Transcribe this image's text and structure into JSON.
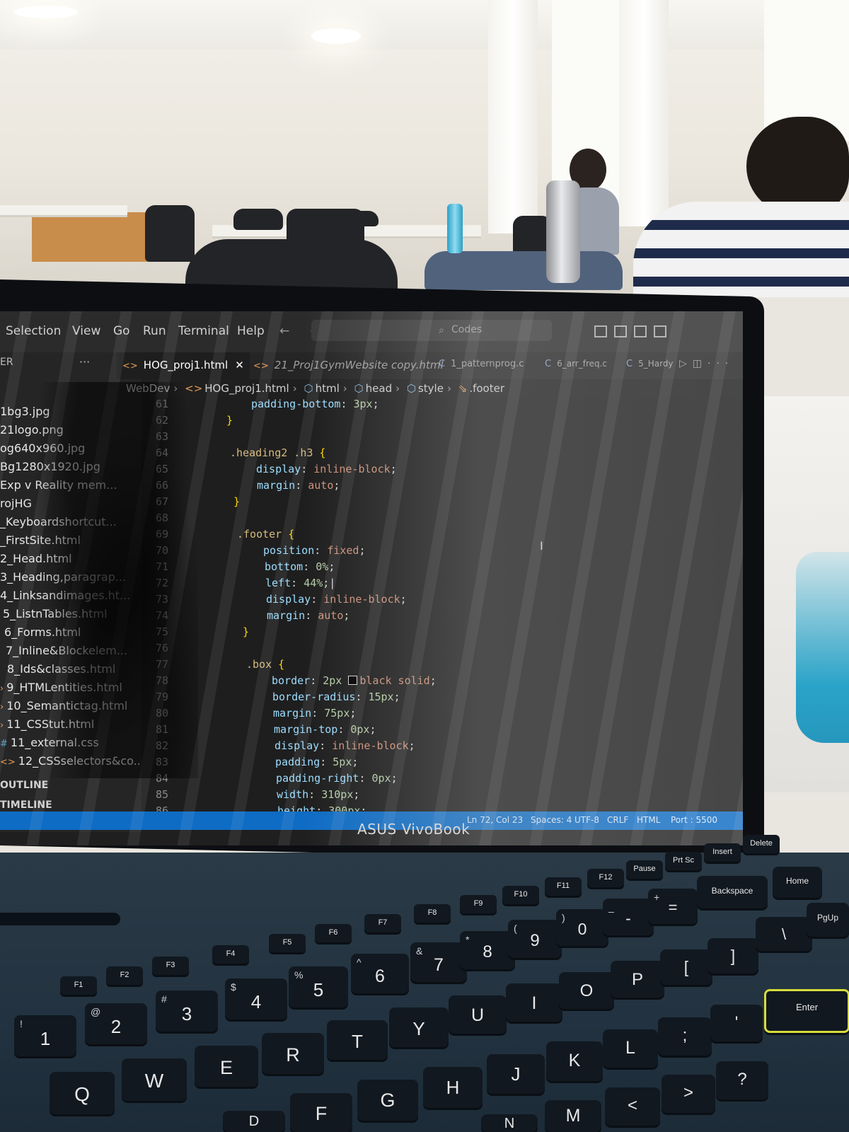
{
  "menubar": {
    "items": [
      "Selection",
      "View",
      "Go",
      "Run",
      "Terminal",
      "Help"
    ],
    "nav_arrows": "← →",
    "command_center": "Codes"
  },
  "explorer": {
    "header": "ER",
    "dots": "···",
    "files": [
      {
        "name": "1bg3.jpg",
        "icon": "image-file-icon"
      },
      {
        "name": "21logo.png",
        "icon": "image-file-icon"
      },
      {
        "name": "og640x960.jpg",
        "icon": "image-file-icon"
      },
      {
        "name": "Bg1280x1920.jpg",
        "icon": "image-file-icon"
      },
      {
        "name": "Exp v Reality mem...",
        "icon": "image-file-icon"
      },
      {
        "name": "rojHG",
        "icon": "folder-icon"
      },
      {
        "name": "_Keyboardshortcut...",
        "icon": "html-file-icon"
      },
      {
        "name": "_FirstSite.html",
        "icon": "html-file-icon"
      },
      {
        "name": "2_Head.html",
        "icon": "html-file-icon"
      },
      {
        "name": "3_Heading,paragrap...",
        "icon": "html-file-icon"
      },
      {
        "name": "4_Linksandimages.ht...",
        "icon": "html-file-icon"
      },
      {
        "name": "5_ListnTables.html",
        "icon": "html-file-icon"
      },
      {
        "name": "6_Forms.html",
        "icon": "html-file-icon"
      },
      {
        "name": "7_Inline&Blockelem...",
        "icon": "html-file-icon"
      },
      {
        "name": "8_Ids&classes.html",
        "icon": "html-file-icon"
      },
      {
        "name": "9_HTMLentities.html",
        "icon": "html-file-icon"
      },
      {
        "name": "10_Semantictag.html",
        "icon": "html-file-icon"
      },
      {
        "name": "11_CSStut.html",
        "icon": "html-file-icon"
      },
      {
        "name": "11_external.css",
        "icon": "css-file-icon"
      },
      {
        "name": "12_CSSselectors&co...",
        "icon": "html-file-icon"
      }
    ],
    "outline_label": "OUTLINE",
    "timeline_label": "TIMELINE"
  },
  "tabs": [
    {
      "label": "HOG_proj1.html",
      "active": true,
      "icon": "html-tab-icon"
    },
    {
      "label": "21_Proj1GymWebsite copy.html",
      "active": false,
      "icon": "html-tab-icon"
    },
    {
      "label": "1_patternprog.c",
      "active": false,
      "icon": "c-file-icon"
    },
    {
      "label": "6_arr_freq.c",
      "active": false,
      "icon": "c-file-icon"
    },
    {
      "label": "5_Hardy",
      "active": false,
      "icon": "c-file-icon"
    }
  ],
  "breadcrumb": {
    "root": "WebDev",
    "file": "HOG_proj1.html",
    "html": "html",
    "head": "head",
    "style": "style",
    "selector": ".footer"
  },
  "editor": {
    "line_numbers": [
      "61",
      "62",
      "63",
      "64",
      "65",
      "66",
      "67",
      "68",
      "69",
      "70",
      "71",
      "72",
      "73",
      "74",
      "75",
      "76",
      "77",
      "78",
      "79",
      "80",
      "81",
      "82",
      "83",
      "84",
      "85",
      "86"
    ],
    "lines": {
      "l61_prop": "padding-bottom",
      "l61_val": "3px",
      "l62": "}",
      "l64_sel": ".heading2 .h3",
      "l65_prop": "display",
      "l65_val": "inline-block",
      "l66_prop": "margin",
      "l66_val": "auto",
      "l67": "}",
      "l69_sel": ".footer",
      "l70_prop": "position",
      "l70_val": "fixed",
      "l71_prop": "bottom",
      "l71_val": "0%",
      "l72_prop": "left",
      "l72_val": "44%",
      "l73_prop": "display",
      "l73_val": "inline-block",
      "l74_prop": "margin",
      "l74_val": "auto",
      "l75": "}",
      "l77_sel": ".box",
      "l78_prop": "border",
      "l78_num": "2px",
      "l78_val": "black solid",
      "l79_prop": "border-radius",
      "l79_val": "15px",
      "l80_prop": "margin",
      "l80_val": "75px",
      "l81_prop": "margin-top",
      "l81_val": "0px",
      "l82_prop": "display",
      "l82_val": "inline-block",
      "l83_prop": "padding",
      "l83_val": "5px",
      "l84_prop": "padding-right",
      "l84_val": "0px",
      "l85_prop": "width",
      "l85_val": "310px",
      "l86_prop": "height",
      "l86_val": "300px"
    }
  },
  "statusbar": {
    "position": "Ln 72, Col 23",
    "spaces": "Spaces: 4",
    "encoding": "UTF-8",
    "eol": "CRLF",
    "language": "HTML",
    "port": "Port : 5500"
  },
  "device": {
    "brand": "ASUS VivoBook"
  },
  "keyboard": {
    "fn_row": [
      "F1",
      "F2",
      "F3",
      "F4",
      "F5",
      "F6",
      "F7",
      "F8",
      "F9",
      "F10",
      "F11",
      "F12",
      "Pause",
      "Prt Sc",
      "Insert",
      "Delete"
    ],
    "number_row": [
      {
        "main": "1",
        "sub": "!"
      },
      {
        "main": "2",
        "sub": "@"
      },
      {
        "main": "3",
        "sub": "#"
      },
      {
        "main": "4",
        "sub": "$"
      },
      {
        "main": "5",
        "sub": "%"
      },
      {
        "main": "6",
        "sub": "^"
      },
      {
        "main": "7",
        "sub": "&"
      },
      {
        "main": "8",
        "sub": "*"
      },
      {
        "main": "9",
        "sub": "("
      },
      {
        "main": "0",
        "sub": ")"
      },
      {
        "main": "-",
        "sub": "_"
      },
      {
        "main": "=",
        "sub": "+"
      }
    ],
    "backspace": "Backspace",
    "home": "Home",
    "top_row": [
      "Q",
      "W",
      "E",
      "R",
      "T",
      "Y",
      "U",
      "I",
      "O",
      "P",
      "[",
      "]",
      "\\"
    ],
    "pgup": "PgUp",
    "home_row": [
      "F",
      "G",
      "H",
      "J",
      "K",
      "L",
      ";",
      "'"
    ],
    "enter": "Enter",
    "bottom_row": [
      "N",
      "M",
      "<",
      ">",
      "?"
    ],
    "extra_row": [
      "D"
    ],
    "colors": {
      "deck": "#223240",
      "key": "#111820",
      "enter_border": "#d8dc3c"
    }
  },
  "colors": {
    "statusbar": "#0e6cc4",
    "editor_bg": "#1e1e1e",
    "selector": "#d7ba7d",
    "property": "#9cdcfe",
    "value": "#ce9178"
  }
}
